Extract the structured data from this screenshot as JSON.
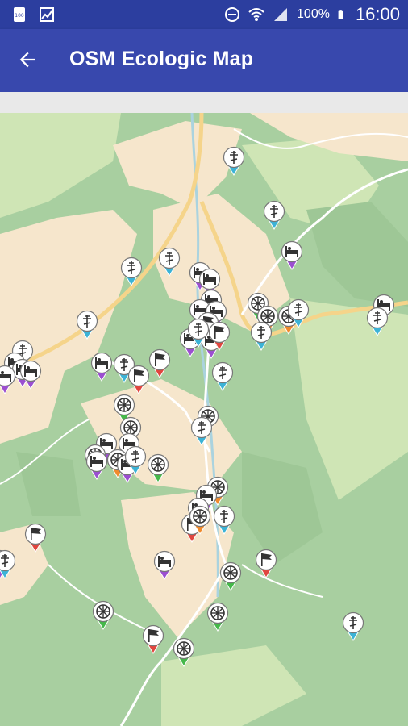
{
  "status_bar": {
    "battery_saver_label": "100",
    "battery": "100%",
    "time": "16:00",
    "icons": [
      "battery-100-icon",
      "photo-icon",
      "do-not-disturb-icon",
      "wifi-icon",
      "signal-icon",
      "battery-icon"
    ]
  },
  "app_bar": {
    "title": "OSM Ecologic Map",
    "back_icon": "arrow-back-icon"
  },
  "map": {
    "colors": {
      "forest": "#a8cfa0",
      "forest_dark": "#9ec796",
      "meadow": "#cfe5b5",
      "residential": "#f6e6cc",
      "road": "#ffffff",
      "road_major": "#f5d48a",
      "water": "#aad3df"
    },
    "marker_types": {
      "church": {
        "color": "#3cb3d6",
        "icon": "orthodox-cross-icon"
      },
      "hotel": {
        "color": "#9b4fd0",
        "icon": "bed-icon"
      },
      "flag": {
        "color": "#e0463f",
        "icon": "flag-icon"
      },
      "recycle": {
        "color": "#45b84a",
        "icon": "recycling-icon"
      },
      "wheel": {
        "color": "#f08a2c",
        "icon": "wheel-icon"
      }
    },
    "marker_count": 62
  }
}
